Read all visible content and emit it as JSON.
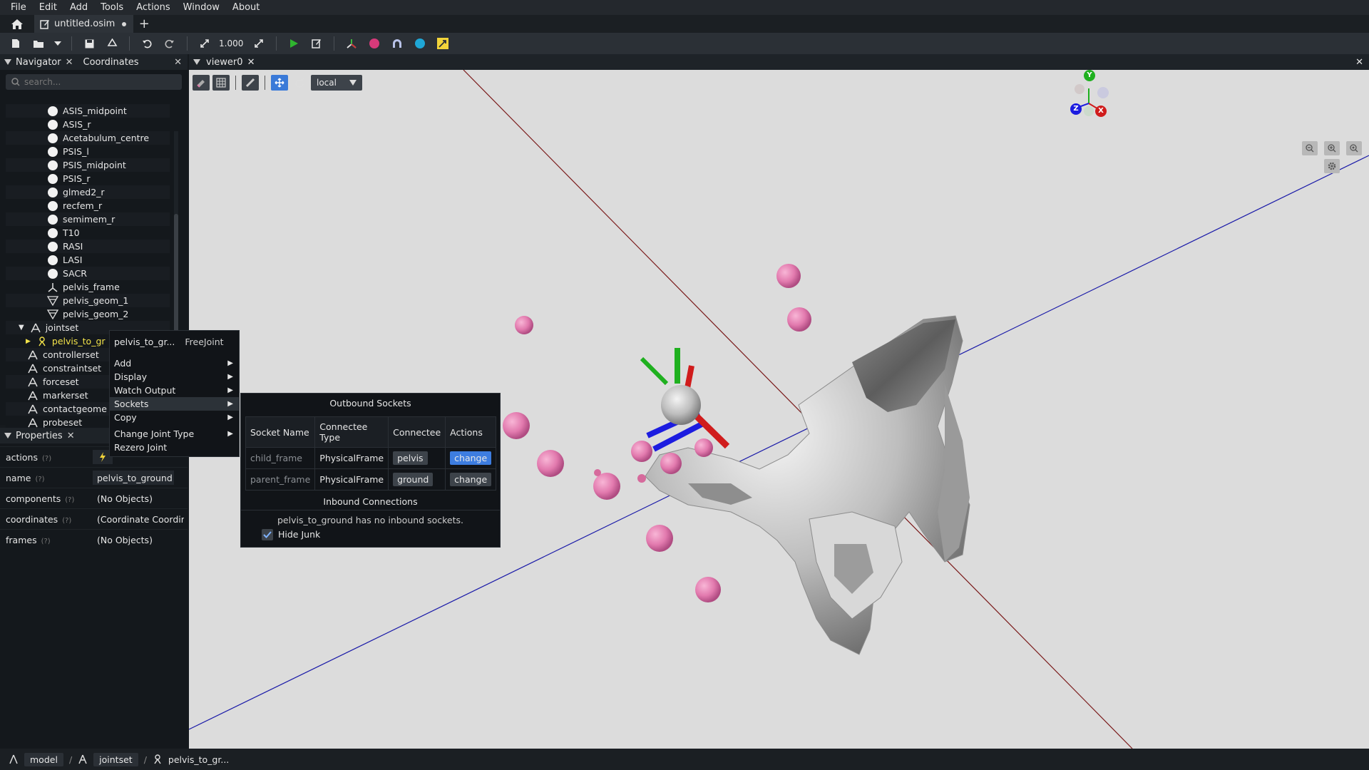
{
  "menubar": [
    "File",
    "Edit",
    "Add",
    "Tools",
    "Actions",
    "Window",
    "About"
  ],
  "tabs": {
    "doc_title": "untitled.osim",
    "new_tab": "+"
  },
  "toolbar": {
    "scale_value": "1.000"
  },
  "navigator": {
    "title": "Navigator",
    "coordinates_title": "Coordinates",
    "search_placeholder": "search...",
    "items": [
      {
        "label": "ASIS_midpoint",
        "icon": "marker-dot-icon"
      },
      {
        "label": "ASIS_r",
        "icon": "marker-dot-icon"
      },
      {
        "label": "Acetabulum_centre",
        "icon": "marker-dot-icon"
      },
      {
        "label": "PSIS_l",
        "icon": "marker-dot-icon"
      },
      {
        "label": "PSIS_midpoint",
        "icon": "marker-dot-icon"
      },
      {
        "label": "PSIS_r",
        "icon": "marker-dot-icon"
      },
      {
        "label": "glmed2_r",
        "icon": "marker-dot-icon"
      },
      {
        "label": "recfem_r",
        "icon": "marker-dot-icon"
      },
      {
        "label": "semimem_r",
        "icon": "marker-dot-icon"
      },
      {
        "label": "T10",
        "icon": "marker-dot-icon"
      },
      {
        "label": "RASI",
        "icon": "marker-dot-icon"
      },
      {
        "label": "LASI",
        "icon": "marker-dot-icon"
      },
      {
        "label": "SACR",
        "icon": "marker-dot-icon"
      },
      {
        "label": "pelvis_frame",
        "icon": "frame-axes-icon"
      },
      {
        "label": "pelvis_geom_1",
        "icon": "mesh-icon"
      },
      {
        "label": "pelvis_geom_2",
        "icon": "mesh-icon"
      },
      {
        "label": "jointset",
        "icon": "set-icon"
      },
      {
        "label": "pelvis_to_gr",
        "icon": "joint-icon"
      },
      {
        "label": "controllerset",
        "icon": "set-icon"
      },
      {
        "label": "constraintset",
        "icon": "set-icon"
      },
      {
        "label": "forceset",
        "icon": "set-icon"
      },
      {
        "label": "markerset",
        "icon": "set-icon"
      },
      {
        "label": "contactgeome",
        "icon": "set-icon"
      },
      {
        "label": "probeset",
        "icon": "set-icon"
      }
    ]
  },
  "properties": {
    "title": "Properties",
    "rows": [
      {
        "name": "actions",
        "help": "(?)",
        "value": ""
      },
      {
        "name": "name",
        "help": "(?)",
        "value": "pelvis_to_ground"
      },
      {
        "name": "components",
        "help": "(?)",
        "value": "(No Objects)"
      },
      {
        "name": "coordinates",
        "help": "(?)",
        "value": "(Coordinate Coordina"
      },
      {
        "name": "frames",
        "help": "(?)",
        "value": "(No Objects)"
      }
    ]
  },
  "viewer": {
    "title": "viewer0",
    "frame_mode": "local",
    "gizmo_labels": {
      "y": "Y",
      "x": "X",
      "z": "Z"
    }
  },
  "context_menu": {
    "title": "pelvis_to_gr...",
    "type": "FreeJoint",
    "items": [
      {
        "label": "Add",
        "submenu": true
      },
      {
        "label": "Display",
        "submenu": true
      },
      {
        "label": "Watch Output",
        "submenu": true
      },
      {
        "label": "Sockets",
        "submenu": true
      },
      {
        "label": "Copy",
        "submenu": true
      },
      {
        "label": "Change Joint Type",
        "submenu": true
      },
      {
        "label": "Rezero Joint",
        "submenu": false
      }
    ]
  },
  "sockets": {
    "outbound_title": "Outbound Sockets",
    "columns": [
      "Socket Name",
      "Connectee Type",
      "Connectee",
      "Actions"
    ],
    "rows": [
      {
        "name": "child_frame",
        "type": "PhysicalFrame",
        "connectee": "pelvis",
        "action": "change"
      },
      {
        "name": "parent_frame",
        "type": "PhysicalFrame",
        "connectee": "ground",
        "action": "change"
      }
    ],
    "inbound_title": "Inbound Connections",
    "inbound_text": "pelvis_to_ground has no inbound sockets.",
    "hide_junk_label": "Hide Junk",
    "hide_junk_checked": true
  },
  "statusbar": {
    "crumbs": [
      "model",
      "jointset",
      "pelvis_to_gr..."
    ],
    "separator": "/"
  },
  "colors": {
    "accent_blue": "#3d7de0",
    "marker_pink": "#e27aae",
    "highlight_yellow": "#f2e24a",
    "axis_red": "#cc2222",
    "axis_green": "#22aa22",
    "axis_blue": "#2222cc"
  }
}
